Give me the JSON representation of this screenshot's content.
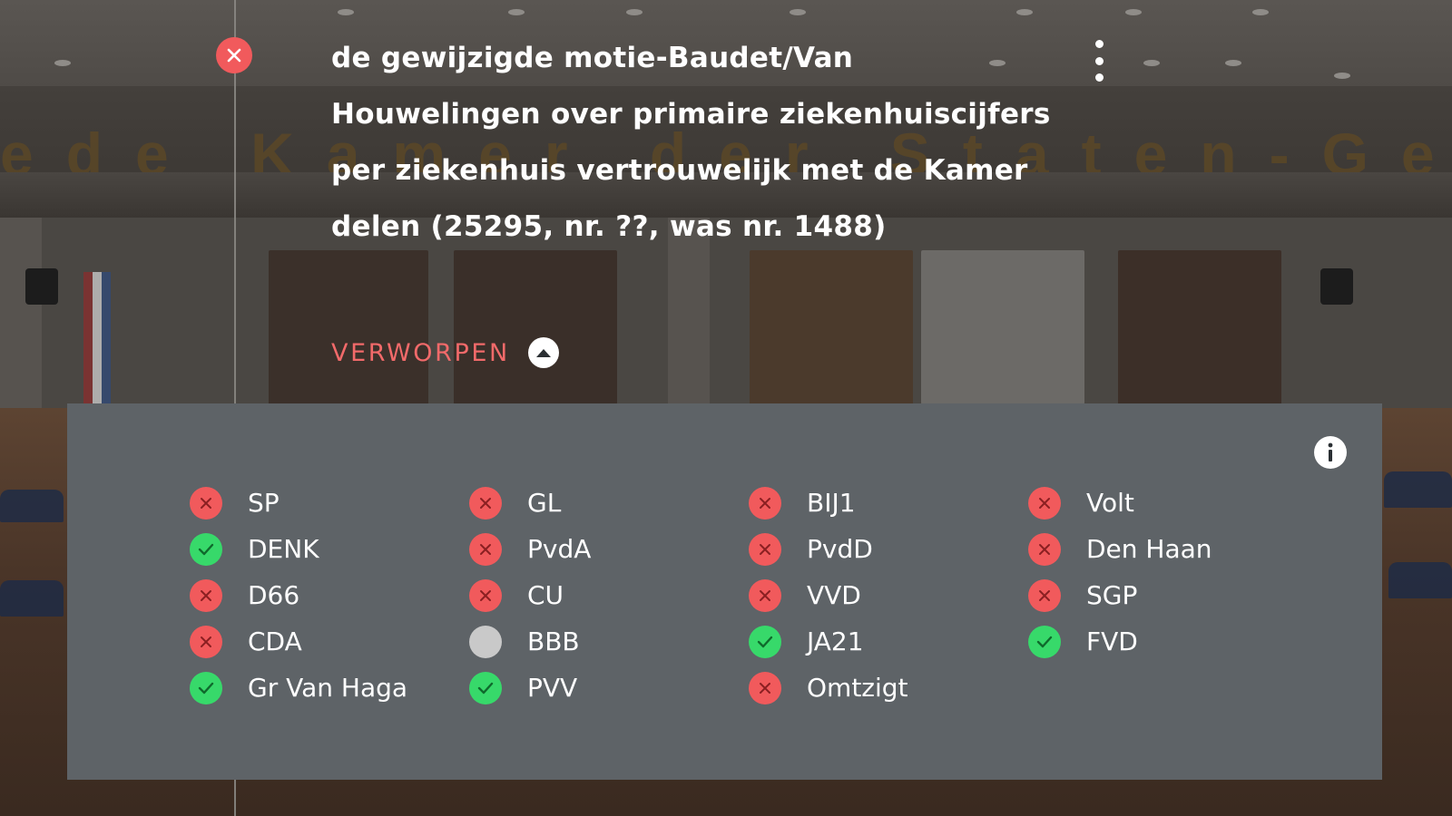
{
  "motion": {
    "title": "de gewijzigde motie-Baudet/Van Houwelingen over primaire ziekenhuiscijfers per ziekenhuis vertrouwelijk met de Kamer delen (25295, nr. ??, was nr. 1488)",
    "result": "VERWORPEN"
  },
  "icons": {
    "close": "close-icon",
    "more": "more-vertical-icon",
    "collapse": "chevron-up-icon",
    "info": "info-icon"
  },
  "colors": {
    "against": "#f15a5c",
    "for": "#37d96a",
    "absent": "#c9c9c9",
    "result": "#f26a6a",
    "panel": "#5e6367"
  },
  "parties": [
    {
      "name": "SP",
      "vote": "against"
    },
    {
      "name": "GL",
      "vote": "against"
    },
    {
      "name": "BIJ1",
      "vote": "against"
    },
    {
      "name": "Volt",
      "vote": "against"
    },
    {
      "name": "DENK",
      "vote": "for"
    },
    {
      "name": "PvdA",
      "vote": "against"
    },
    {
      "name": "PvdD",
      "vote": "against"
    },
    {
      "name": "Den Haan",
      "vote": "against"
    },
    {
      "name": "D66",
      "vote": "against"
    },
    {
      "name": "CU",
      "vote": "against"
    },
    {
      "name": "VVD",
      "vote": "against"
    },
    {
      "name": "SGP",
      "vote": "against"
    },
    {
      "name": "CDA",
      "vote": "against"
    },
    {
      "name": "BBB",
      "vote": "absent"
    },
    {
      "name": "JA21",
      "vote": "for"
    },
    {
      "name": "FVD",
      "vote": "for"
    },
    {
      "name": "Gr Van Haga",
      "vote": "for"
    },
    {
      "name": "PVV",
      "vote": "for"
    },
    {
      "name": "Omtzigt",
      "vote": "against"
    }
  ]
}
